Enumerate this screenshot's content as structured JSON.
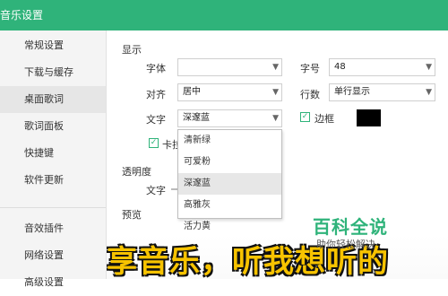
{
  "window": {
    "title": "音乐设置"
  },
  "sidebar": {
    "items": [
      {
        "label": "常规设置"
      },
      {
        "label": "下载与缓存"
      },
      {
        "label": "桌面歌词",
        "active": true
      },
      {
        "label": "歌词面板"
      },
      {
        "label": "快捷键"
      },
      {
        "label": "软件更新"
      },
      {
        "label": "音效插件"
      },
      {
        "label": "网络设置"
      },
      {
        "label": "高级设置"
      }
    ]
  },
  "display": {
    "section_label": "显示",
    "font_label": "字体",
    "font_value": "",
    "size_label": "字号",
    "size_value": "48",
    "align_label": "对齐",
    "align_value": "居中",
    "rows_label": "行数",
    "rows_value": "单行显示",
    "text_label": "文字",
    "text_value": "深邃蓝",
    "border_label": "边框",
    "border_checked": true,
    "border_color": "#000000",
    "karaoke_label": "卡拉",
    "karaoke_checked": true
  },
  "color_dropdown": {
    "options": [
      "清新绿",
      "可爱粉",
      "深邃蓝",
      "高雅灰",
      "活力黄"
    ],
    "highlighted": "深邃蓝"
  },
  "transparency": {
    "section_label": "透明度",
    "text_label": "文字"
  },
  "preview": {
    "section_label": "预览",
    "lyric_text": "享音乐，听我想听的"
  },
  "watermark": {
    "brand": "百科全说",
    "tagline": "助你轻松解决"
  },
  "colors": {
    "accent": "#2fb37a",
    "lyric_fill": "#f7c300",
    "lyric_stroke": "#111111"
  }
}
